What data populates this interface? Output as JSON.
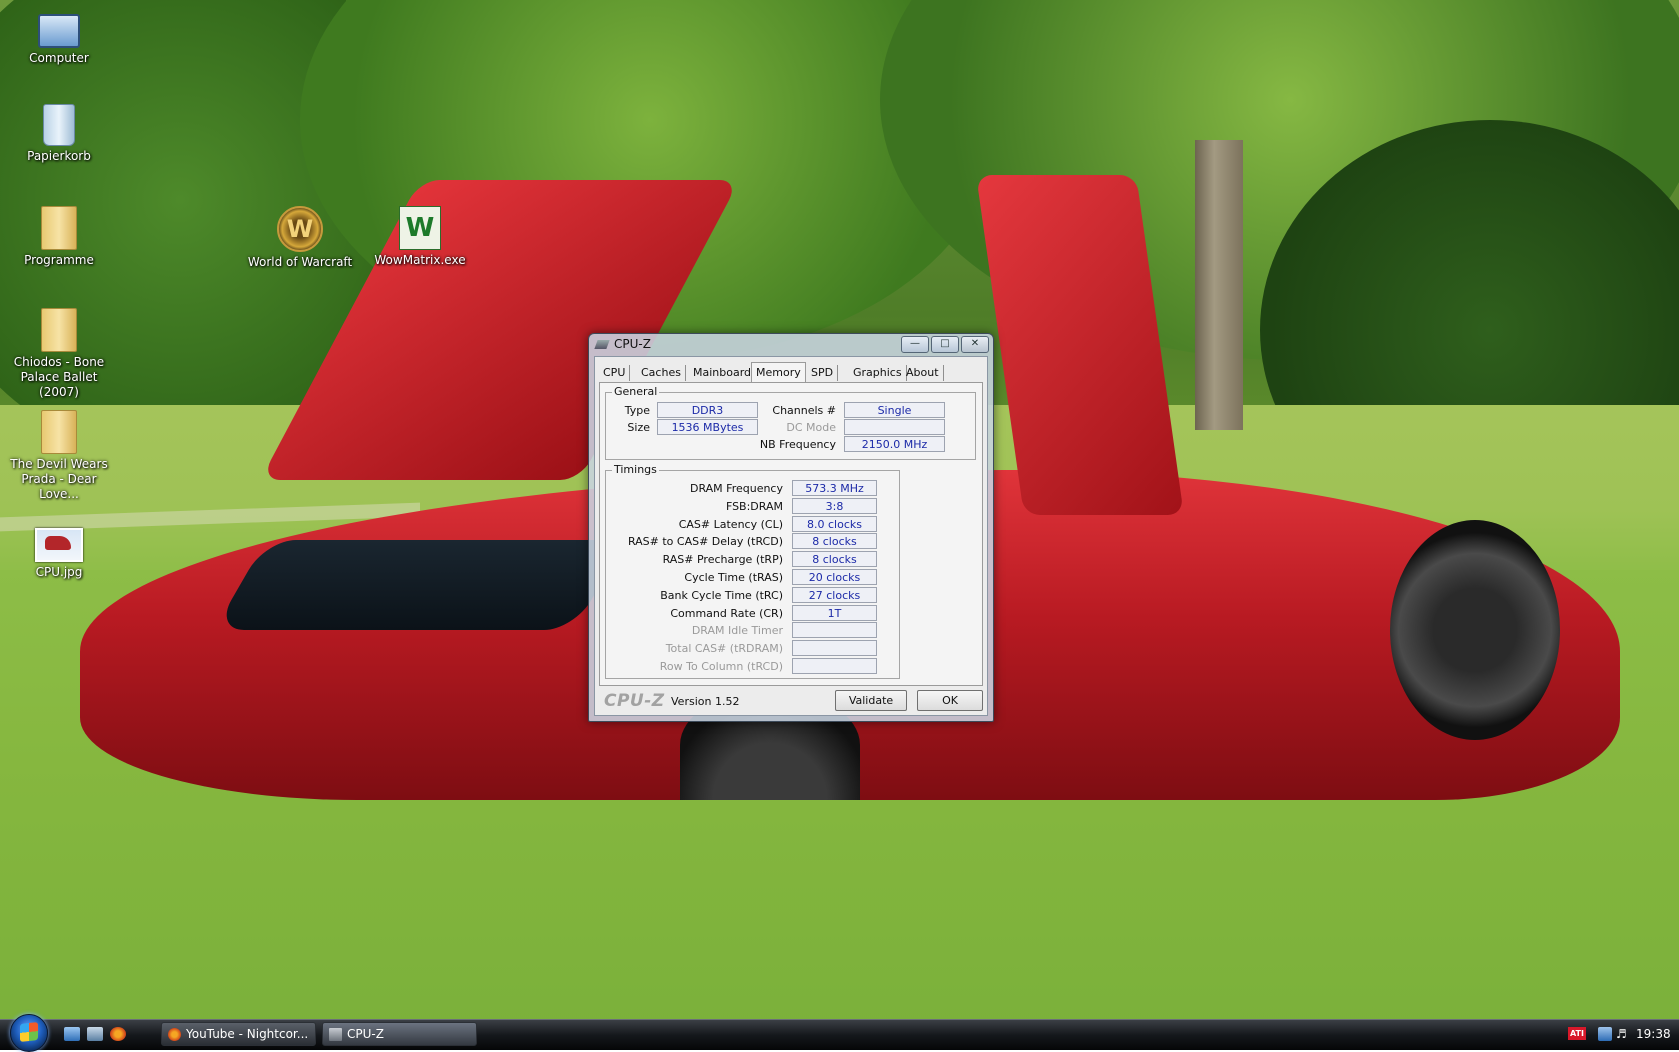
{
  "desktop": {
    "icons": [
      {
        "label": "Computer",
        "icon": "computer-icon"
      },
      {
        "label": "Papierkorb",
        "icon": "recycle-bin-icon"
      },
      {
        "label": "Programme",
        "icon": "folder-icon"
      },
      {
        "label": "Chiodos - Bone Palace Ballet (2007)",
        "icon": "folder-icon"
      },
      {
        "label": "The Devil Wears Prada - Dear Love...",
        "icon": "folder-icon"
      },
      {
        "label": "CPU.jpg",
        "icon": "image-file-icon"
      },
      {
        "label": "World of Warcraft",
        "icon": "world-of-warcraft-icon"
      },
      {
        "label": "WowMatrix.exe",
        "icon": "wowmatrix-icon"
      }
    ]
  },
  "window": {
    "title": "CPU-Z",
    "tabs": [
      "CPU",
      "Caches",
      "Mainboard",
      "Memory",
      "SPD",
      "Graphics",
      "About"
    ],
    "active_tab": "Memory",
    "general": {
      "title": "General",
      "type_label": "Type",
      "type_value": "DDR3",
      "size_label": "Size",
      "size_value": "1536 MBytes",
      "channels_label": "Channels #",
      "channels_value": "Single",
      "dcmode_label": "DC Mode",
      "dcmode_value": "",
      "nbfreq_label": "NB Frequency",
      "nbfreq_value": "2150.0 MHz"
    },
    "timings": {
      "title": "Timings",
      "rows": [
        {
          "label": "DRAM Frequency",
          "value": "573.3 MHz",
          "enabled": true
        },
        {
          "label": "FSB:DRAM",
          "value": "3:8",
          "enabled": true
        },
        {
          "label": "CAS# Latency (CL)",
          "value": "8.0 clocks",
          "enabled": true
        },
        {
          "label": "RAS# to CAS# Delay (tRCD)",
          "value": "8 clocks",
          "enabled": true
        },
        {
          "label": "RAS# Precharge (tRP)",
          "value": "8 clocks",
          "enabled": true
        },
        {
          "label": "Cycle Time (tRAS)",
          "value": "20 clocks",
          "enabled": true
        },
        {
          "label": "Bank Cycle Time (tRC)",
          "value": "27 clocks",
          "enabled": true
        },
        {
          "label": "Command Rate (CR)",
          "value": "1T",
          "enabled": true
        },
        {
          "label": "DRAM Idle Timer",
          "value": "",
          "enabled": false
        },
        {
          "label": "Total CAS# (tRDRAM)",
          "value": "",
          "enabled": false
        },
        {
          "label": "Row To Column (tRCD)",
          "value": "",
          "enabled": false
        }
      ]
    },
    "footer": {
      "logo": "CPU-Z",
      "version": "Version 1.52",
      "validate_label": "Validate",
      "ok_label": "OK"
    }
  },
  "taskbar": {
    "tasks": [
      {
        "label": "YouTube - Nightcor...",
        "icon": "firefox-icon"
      },
      {
        "label": "CPU-Z",
        "icon": "cpuz-icon"
      }
    ],
    "tray_badge": "ATI",
    "clock": "19:38"
  }
}
